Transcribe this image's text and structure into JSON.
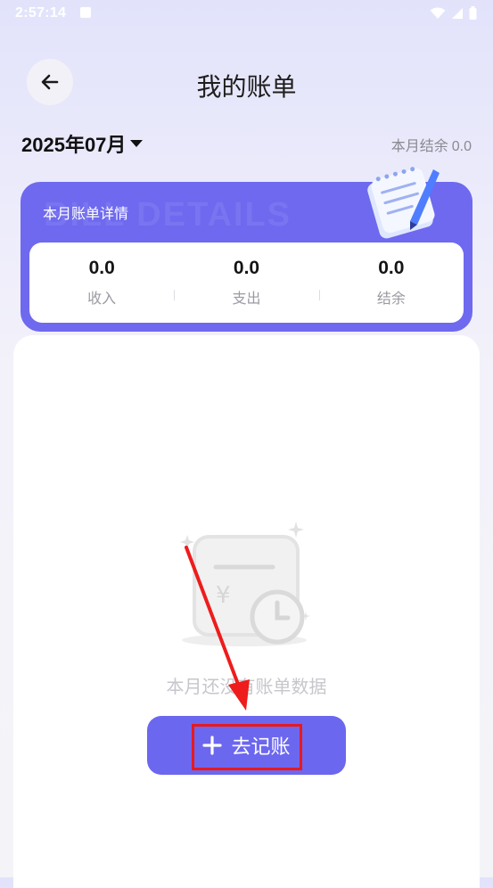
{
  "status_bar": {
    "time": "2:57:14"
  },
  "header": {
    "title": "我的账单"
  },
  "month_picker": {
    "label": "2025年07月"
  },
  "month_balance": {
    "label": "本月结余",
    "value": "0.0"
  },
  "bill_card": {
    "title": "本月账单详情",
    "watermark": "BILL DETAILS",
    "stats": [
      {
        "value": "0.0",
        "label": "收入"
      },
      {
        "value": "0.0",
        "label": "支出"
      },
      {
        "value": "0.0",
        "label": "结余"
      }
    ]
  },
  "empty_state": {
    "text": "本月还没有账单数据"
  },
  "add_button": {
    "label": "去记账"
  },
  "colors": {
    "accent": "#6e69ef",
    "highlight": "#e8191d"
  }
}
